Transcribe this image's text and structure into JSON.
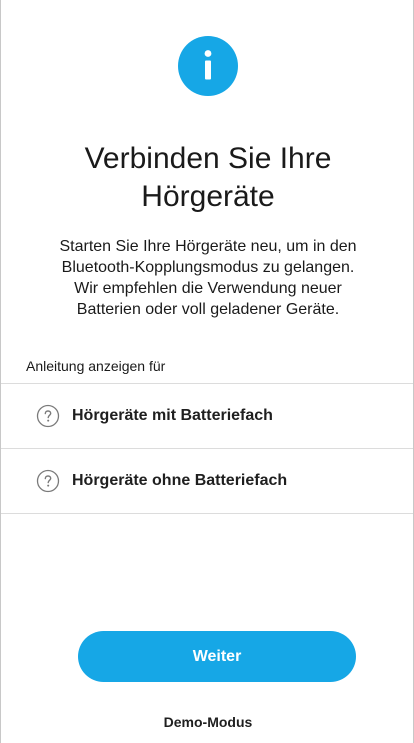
{
  "header": {
    "icon": "info-icon",
    "title_line1": "Verbinden Sie Ihre",
    "title_line2": "Hörgeräte"
  },
  "description": {
    "line1": "Starten Sie Ihre Hörgeräte neu, um in den",
    "line2": "Bluetooth-Kopplungsmodus zu gelangen.",
    "line3": "Wir empfehlen die Verwendung neuer",
    "line4": "Batterien oder voll geladener Geräte."
  },
  "instructions": {
    "label": "Anleitung anzeigen für",
    "options": [
      {
        "label": "Hörgeräte mit Batteriefach",
        "icon": "help-icon"
      },
      {
        "label": "Hörgeräte ohne Batteriefach",
        "icon": "help-icon"
      }
    ]
  },
  "actions": {
    "continue_label": "Weiter",
    "demo_label": "Demo-Modus"
  },
  "colors": {
    "accent": "#16a7e6",
    "text": "#1a1a1a",
    "divider": "#dcdcdc"
  }
}
